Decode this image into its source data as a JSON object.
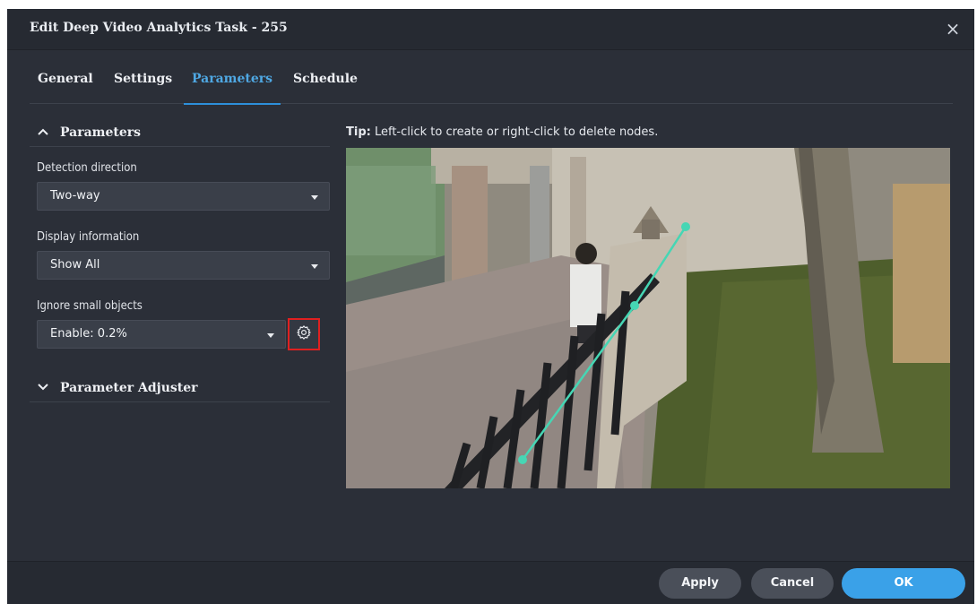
{
  "dialog": {
    "title": "Edit Deep Video Analytics Task - 255",
    "close_glyph": "×"
  },
  "tabs": [
    {
      "label": "General",
      "active": false
    },
    {
      "label": "Settings",
      "active": false
    },
    {
      "label": "Parameters",
      "active": true
    },
    {
      "label": "Schedule",
      "active": false
    }
  ],
  "parameters": {
    "section_title": "Parameters",
    "section_expanded": true,
    "detection_direction": {
      "label": "Detection direction",
      "value": "Two-way"
    },
    "display_information": {
      "label": "Display information",
      "value": "Show All"
    },
    "ignore_small_objects": {
      "label": "Ignore small objects",
      "value": "Enable: 0.2%",
      "settings_icon": "gear-icon"
    }
  },
  "parameter_adjuster": {
    "section_title": "Parameter Adjuster",
    "section_expanded": false
  },
  "tip": {
    "prefix": "Tip:",
    "text": " Left-click to create or right-click to delete nodes."
  },
  "footer": {
    "apply_label": "Apply",
    "cancel_label": "Cancel",
    "ok_label": "OK"
  },
  "colors": {
    "accent": "#3aa1e8",
    "active_tab": "#4fa8e3",
    "highlight_border": "#e02020",
    "line_color": "#46d6b4"
  }
}
